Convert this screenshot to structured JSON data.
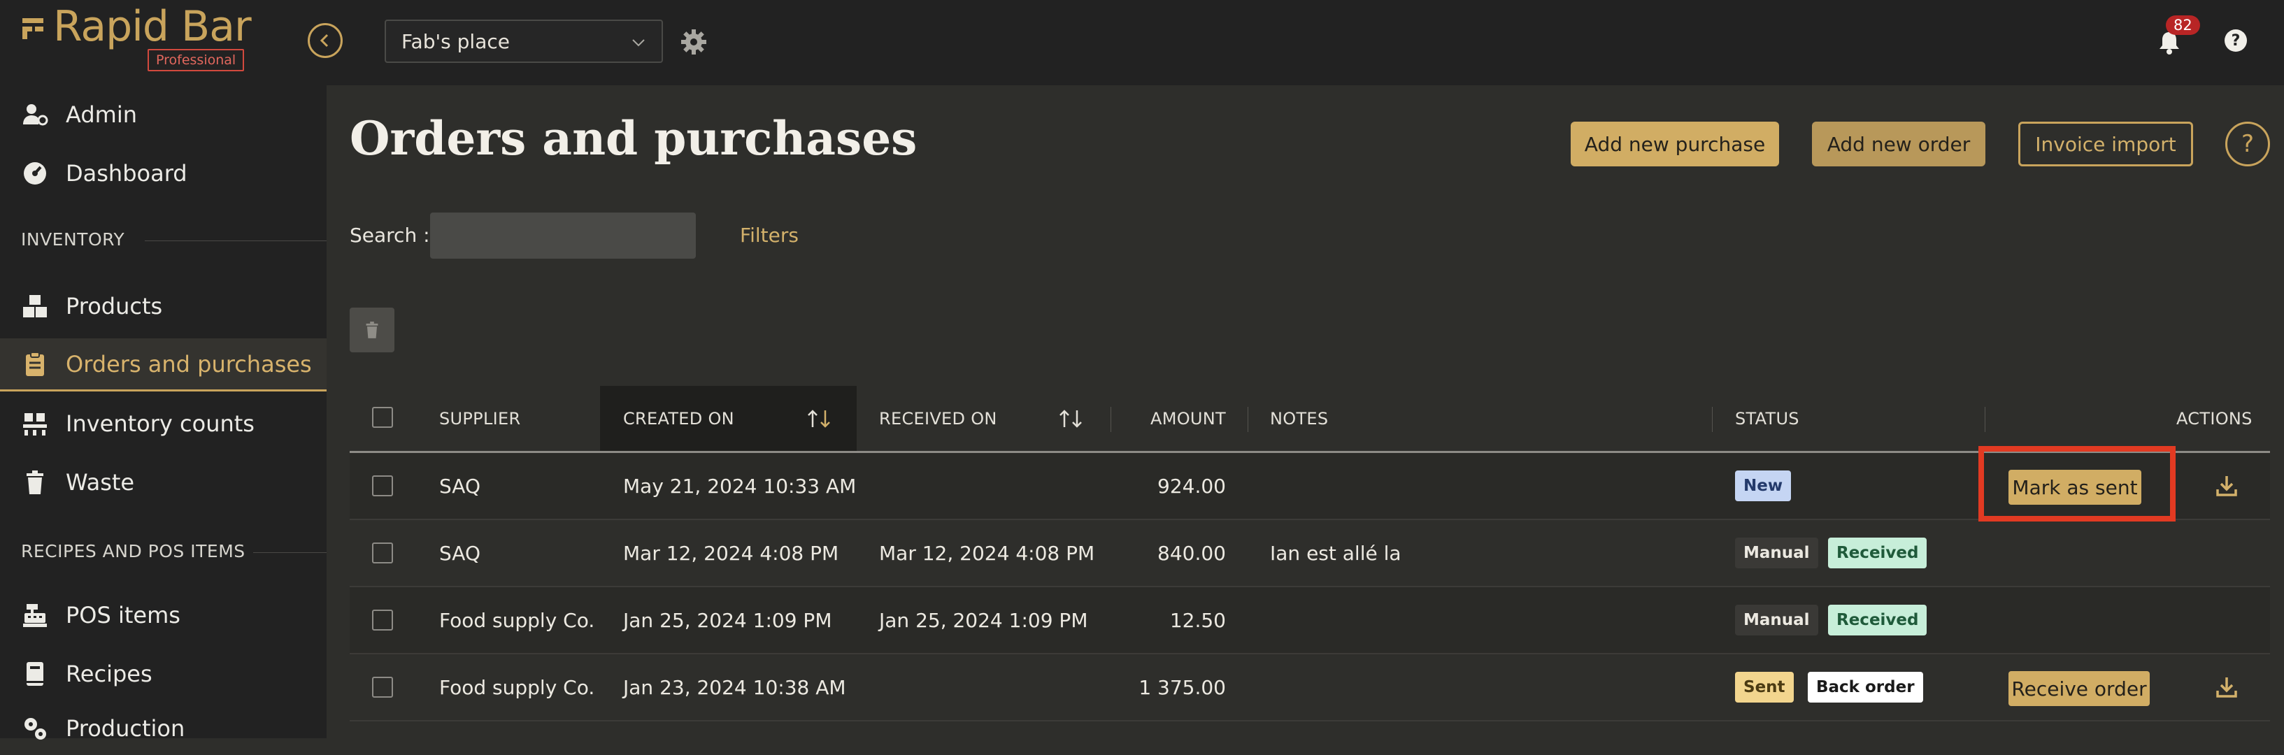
{
  "app": {
    "logo_text": "Rapid Bar",
    "edition_badge": "Professional"
  },
  "topbar": {
    "venue": "Fab's place",
    "notification_count": "82"
  },
  "sidebar": {
    "items": [
      {
        "label": "Admin",
        "icon": "admin-icon"
      },
      {
        "label": "Dashboard",
        "icon": "dashboard-icon"
      }
    ],
    "sections": [
      {
        "title": "INVENTORY",
        "items": [
          {
            "label": "Products",
            "icon": "boxes-icon"
          },
          {
            "label": "Orders and purchases",
            "icon": "clipboard-icon",
            "active": true
          },
          {
            "label": "Inventory counts",
            "icon": "pallet-icon"
          },
          {
            "label": "Waste",
            "icon": "trash-icon"
          }
        ]
      },
      {
        "title": "RECIPES AND POS ITEMS",
        "items": [
          {
            "label": "POS items",
            "icon": "cash-register-icon"
          },
          {
            "label": "Recipes",
            "icon": "book-icon"
          },
          {
            "label": "Production",
            "icon": "production-icon"
          }
        ]
      }
    ]
  },
  "main": {
    "title": "Orders and purchases",
    "buttons": {
      "add_purchase": "Add new purchase",
      "add_order": "Add new order",
      "invoice_import": "Invoice import",
      "help": "?"
    },
    "search": {
      "label": "Search :",
      "value": "",
      "placeholder": ""
    },
    "filters_label": "Filters"
  },
  "table": {
    "columns": {
      "supplier": "SUPPLIER",
      "created_on": "CREATED ON",
      "received_on": "RECEIVED ON",
      "amount": "AMOUNT",
      "notes": "NOTES",
      "status": "STATUS",
      "actions": "ACTIONS"
    },
    "rows": [
      {
        "supplier": "SAQ",
        "created_on": "May 21, 2024 10:33 AM",
        "received_on": "",
        "amount": "924.00",
        "notes": "",
        "statuses": [
          "New"
        ],
        "action": "Mark as sent",
        "download": true
      },
      {
        "supplier": "SAQ",
        "created_on": "Mar 12, 2024 4:08 PM",
        "received_on": "Mar 12, 2024 4:08 PM",
        "amount": "840.00",
        "notes": "Ian est allé la",
        "statuses": [
          "Manual",
          "Received"
        ],
        "action": "",
        "download": false
      },
      {
        "supplier": "Food supply Co.",
        "created_on": "Jan 25, 2024 1:09 PM",
        "received_on": "Jan 25, 2024 1:09 PM",
        "amount": "12.50",
        "notes": "",
        "statuses": [
          "Manual",
          "Received"
        ],
        "action": "",
        "download": false
      },
      {
        "supplier": "Food supply Co.",
        "created_on": "Jan 23, 2024 10:38 AM",
        "received_on": "",
        "amount": "1 375.00",
        "notes": "",
        "statuses": [
          "Sent",
          "Back order"
        ],
        "action": "Receive order",
        "download": true
      }
    ]
  },
  "colors": {
    "accent": "#c9a45c",
    "background": "#2e2e2b",
    "sidebar": "#222222",
    "highlight": "#e23a22"
  }
}
